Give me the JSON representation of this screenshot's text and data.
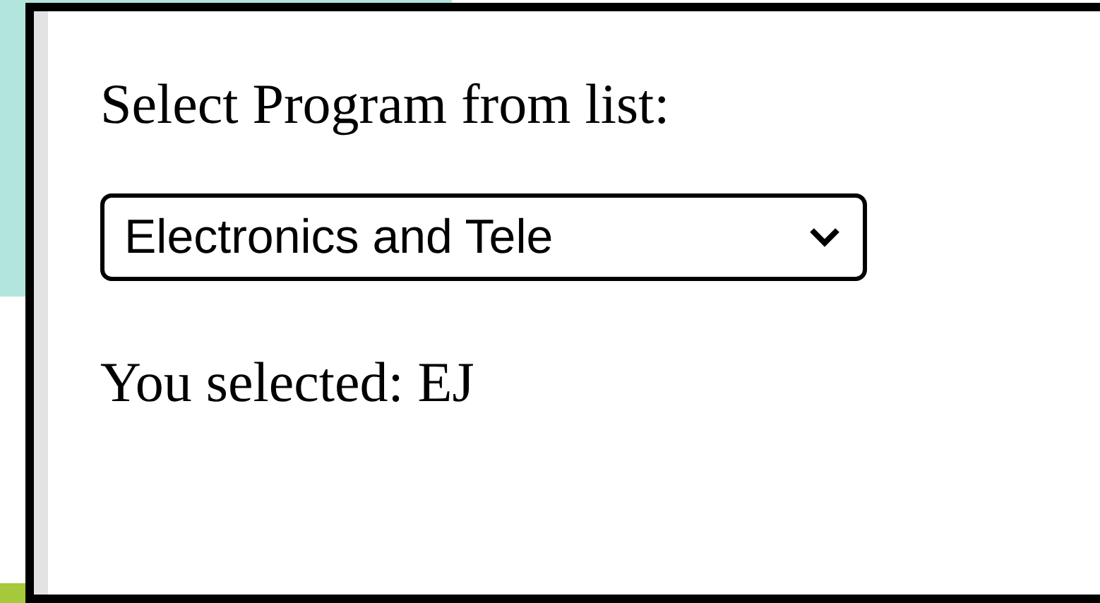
{
  "prompt": "Select Program from list:",
  "select": {
    "value": "Electronics and Tele"
  },
  "result": "You selected: EJ"
}
